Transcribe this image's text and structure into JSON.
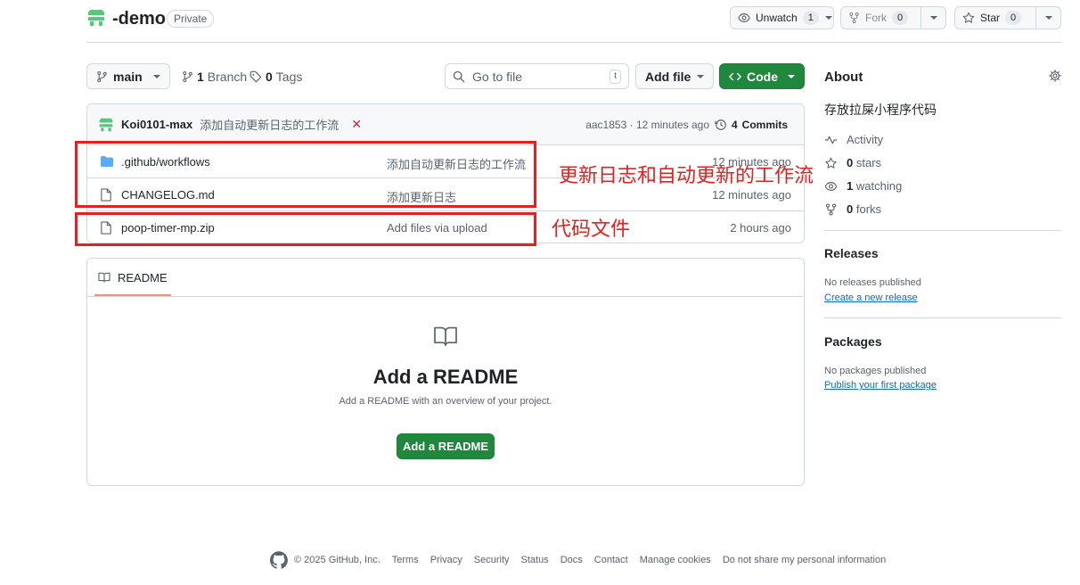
{
  "repo": {
    "name": "-demo",
    "visibility": "Private"
  },
  "header_buttons": {
    "watch": {
      "label": "Unwatch",
      "count": "1"
    },
    "fork": {
      "label": "Fork",
      "count": "0"
    },
    "star": {
      "label": "Star",
      "count": "0"
    }
  },
  "toolbar": {
    "branch": "main",
    "branches_count": "1",
    "branches_label": "Branch",
    "tags_count": "0",
    "tags_label": "Tags",
    "search_placeholder": "Go to file",
    "search_shortcut": "t",
    "add_file": "Add file",
    "code": "Code"
  },
  "latest_commit": {
    "author": "Koi0101-max",
    "message": "添加自动更新日志的工作流",
    "status": "✕",
    "hash": "aac1853",
    "separator": "·",
    "time": "12 minutes ago",
    "commits_count": "4",
    "commits_label": "Commits"
  },
  "files": [
    {
      "name": ".github/workflows",
      "type": "folder",
      "message": "添加自动更新日志的工作流",
      "time": "12 minutes ago"
    },
    {
      "name": "CHANGELOG.md",
      "type": "file",
      "message": "添加更新日志",
      "time": "12 minutes ago"
    },
    {
      "name": "poop-timer-mp.zip",
      "type": "file",
      "message": "Add files via upload",
      "time": "2 hours ago"
    }
  ],
  "annotations": {
    "workflow_note": "更新日志和自动更新的工作流",
    "code_note": "代码文件"
  },
  "readme": {
    "tab_label": "README",
    "title": "Add a README",
    "subtitle": "Add a README with an overview of your project.",
    "button": "Add a README"
  },
  "about": {
    "heading": "About",
    "description": "存放拉屎小程序代码",
    "activity": "Activity",
    "stars_count": "0",
    "stars_label": "stars",
    "watching_count": "1",
    "watching_label": "watching",
    "forks_count": "0",
    "forks_label": "forks"
  },
  "releases": {
    "heading": "Releases",
    "empty": "No releases published",
    "link": "Create a new release"
  },
  "packages": {
    "heading": "Packages",
    "empty": "No packages published",
    "link": "Publish your first package"
  },
  "footer": {
    "copyright": "© 2025 GitHub, Inc.",
    "links": [
      "Terms",
      "Privacy",
      "Security",
      "Status",
      "Docs",
      "Contact",
      "Manage cookies",
      "Do not share my personal information"
    ]
  },
  "colors": {
    "accent_green": "#1f883d",
    "annotation_red": "#e5201f",
    "link_blue": "#0969da"
  }
}
